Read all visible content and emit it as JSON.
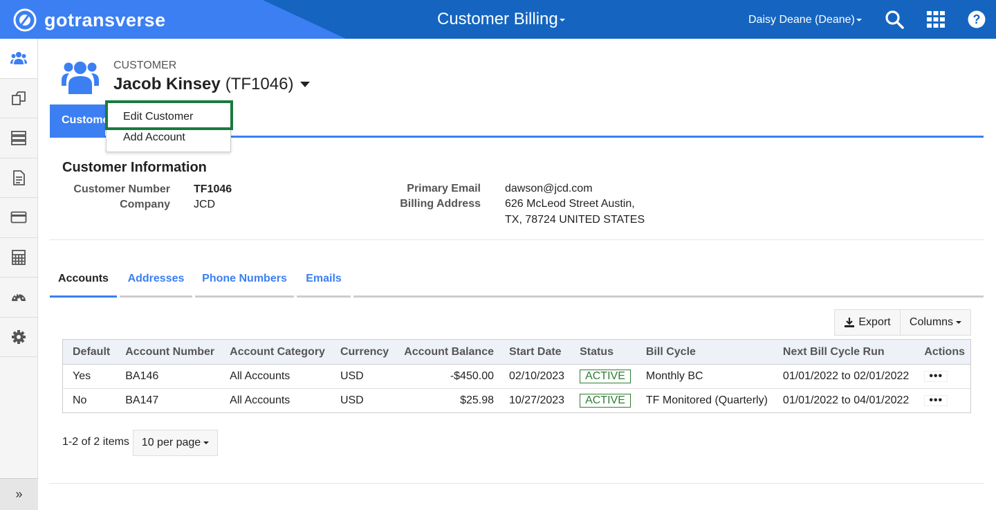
{
  "topbar": {
    "brand": "gotransverse",
    "app_title": "Customer Billing",
    "user": "Daisy Deane (Deane)",
    "icons": [
      "search-icon",
      "apps-grid-icon",
      "help-icon"
    ],
    "colors": {
      "bar": "#1565c0",
      "brand_bg": "#3b7ff2"
    }
  },
  "leftnav": {
    "items": [
      "customers-icon",
      "orders-icon",
      "server-icon",
      "document-icon",
      "credit-card-icon",
      "calculator-icon",
      "dashboard-icon",
      "settings-icon"
    ],
    "expand_label": "»"
  },
  "customer": {
    "label": "CUSTOMER",
    "name": "Jacob Kinsey",
    "id": "(TF1046)"
  },
  "top_tab": {
    "label": "Customer"
  },
  "dropdown": {
    "items": [
      "Edit Customer",
      "Add Account"
    ]
  },
  "info": {
    "title": "Customer Information",
    "customer_number_label": "Customer Number",
    "customer_number": "TF1046",
    "company_label": "Company",
    "company": "JCD",
    "email_label": "Primary Email",
    "email": "dawson@jcd.com",
    "billing_label": "Billing Address",
    "billing_line1": "626 McLeod Street Austin,",
    "billing_line2": "TX, 78724 UNITED STATES"
  },
  "subtabs": [
    "Accounts",
    "Addresses",
    "Phone Numbers",
    "Emails"
  ],
  "toolbar": {
    "export": "Export",
    "columns": "Columns"
  },
  "table": {
    "headers": [
      "Default",
      "Account Number",
      "Account Category",
      "Currency",
      "Account Balance",
      "Start Date",
      "Status",
      "Bill Cycle",
      "Next Bill Cycle Run",
      "Actions"
    ],
    "rows": [
      [
        "Yes",
        "BA146",
        "All Accounts",
        "USD",
        "-$450.00",
        "02/10/2023",
        "ACTIVE",
        "Monthly BC",
        "01/01/2022 to 02/01/2022",
        "•••"
      ],
      [
        "No",
        "BA147",
        "All Accounts",
        "USD",
        "$25.98",
        "10/27/2023",
        "ACTIVE",
        "TF Monitored (Quarterly)",
        "01/01/2022 to 04/01/2022",
        "•••"
      ]
    ]
  },
  "pager": {
    "summary": "1-2 of 2 items",
    "per_page": "10 per page"
  }
}
